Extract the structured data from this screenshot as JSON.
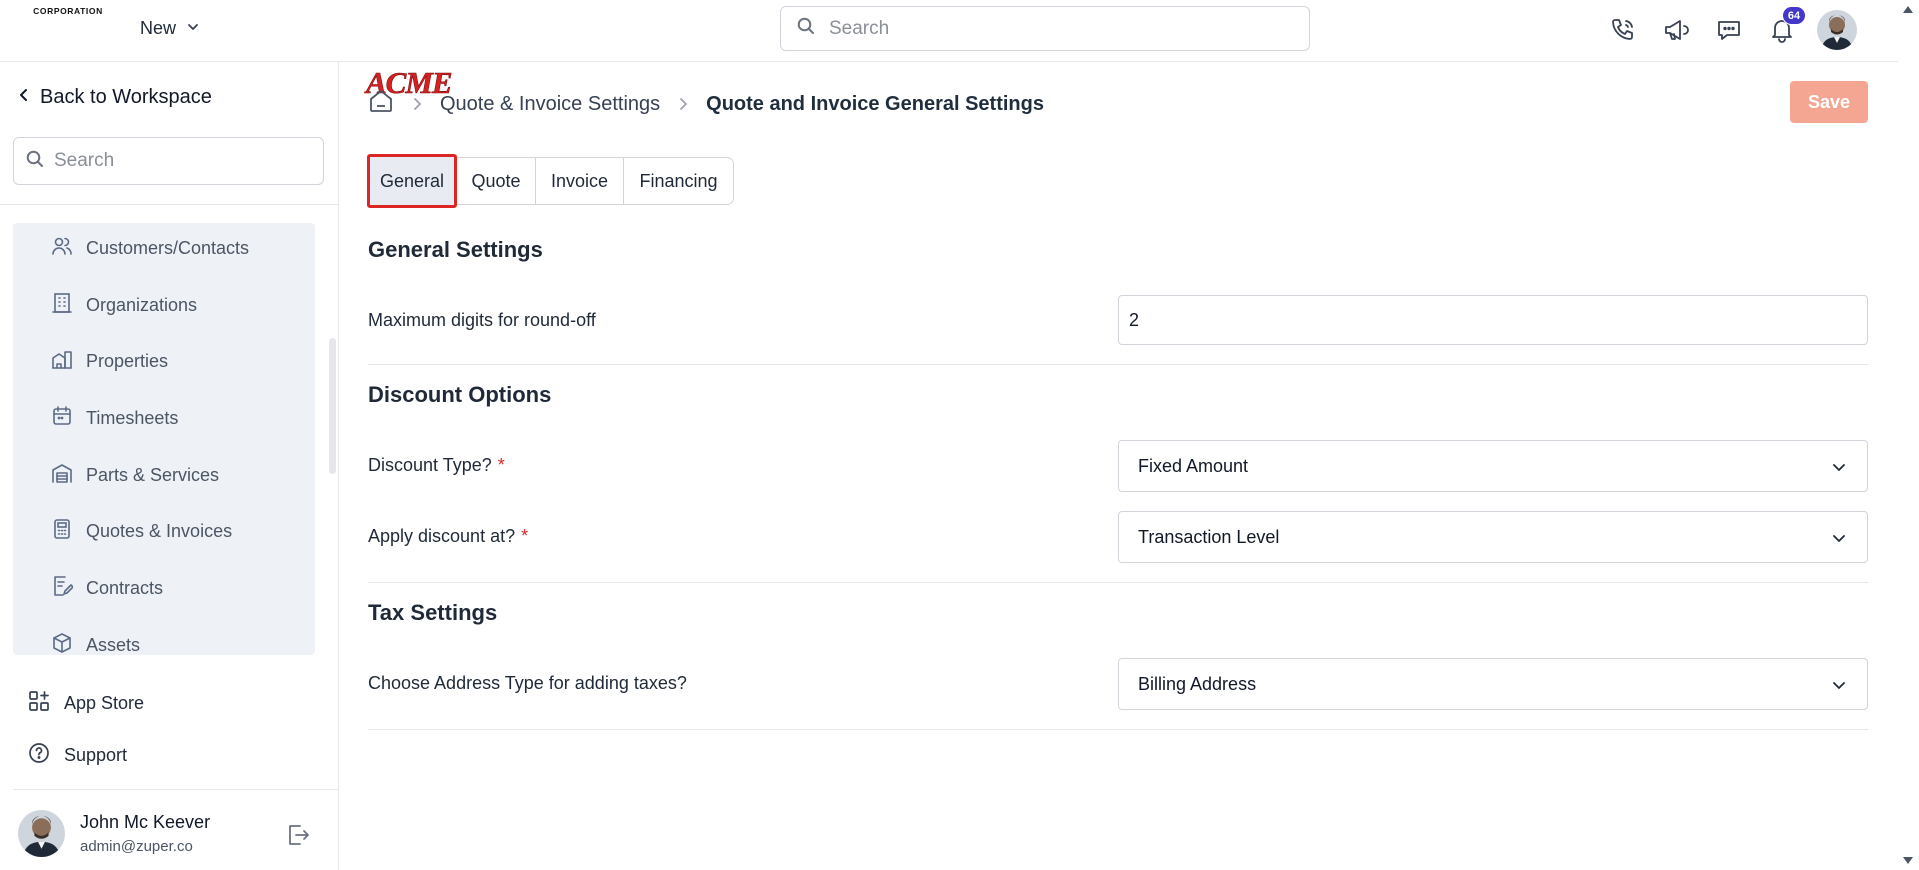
{
  "header": {
    "logo_text": "ACME",
    "logo_subtext": "CORPORATION",
    "new_label": "New",
    "search_placeholder": "Search",
    "notification_count": "64",
    "icons": [
      "phone-icon",
      "megaphone-icon",
      "chat-icon",
      "bell-icon"
    ]
  },
  "sidebar": {
    "back_label": "Back to Workspace",
    "search_placeholder": "Search",
    "items": [
      {
        "label": "Customers/Contacts",
        "icon": "users-icon"
      },
      {
        "label": "Organizations",
        "icon": "building-icon"
      },
      {
        "label": "Properties",
        "icon": "property-icon"
      },
      {
        "label": "Timesheets",
        "icon": "calendar-icon"
      },
      {
        "label": "Parts & Services",
        "icon": "warehouse-icon"
      },
      {
        "label": "Quotes & Invoices",
        "icon": "calculator-icon"
      },
      {
        "label": "Contracts",
        "icon": "contract-icon"
      },
      {
        "label": "Assets",
        "icon": "box-icon"
      }
    ],
    "app_store_label": "App Store",
    "support_label": "Support",
    "user": {
      "name": "John Mc Keever",
      "email": "admin@zuper.co"
    }
  },
  "main": {
    "breadcrumb": {
      "parent": "Quote & Invoice Settings",
      "current": "Quote and Invoice General Settings"
    },
    "save_label": "Save",
    "tabs": [
      "General",
      "Quote",
      "Invoice",
      "Financing"
    ],
    "active_tab": "General",
    "general": {
      "title": "General Settings",
      "round_off_label": "Maximum digits for round-off",
      "round_off_value": "2"
    },
    "discount": {
      "title": "Discount Options",
      "type_label": "Discount Type?",
      "type_value": "Fixed Amount",
      "apply_label": "Apply discount at?",
      "apply_value": "Transaction Level",
      "required_mark": "*"
    },
    "tax": {
      "title": "Tax Settings",
      "address_label": "Choose Address Type for adding taxes?",
      "address_value": "Billing Address"
    }
  },
  "colors": {
    "accent_red": "#dc2626",
    "save_button": "#f4a693",
    "nav_panel": "#eef2f7",
    "badge": "#4338ca"
  }
}
